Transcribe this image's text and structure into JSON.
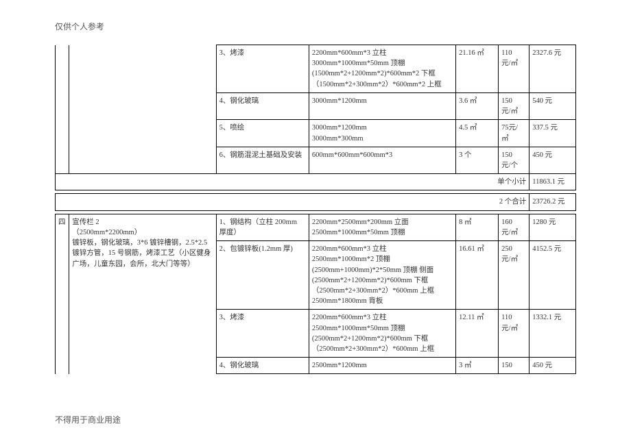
{
  "header_note": "仅供个人参考",
  "footer_note": "不得用于商业用途",
  "section1": {
    "rows": [
      {
        "item": "3、烤漆",
        "spec": "2200mm*600mm*3 立柱\n3000mm*1000mm*50mm 顶棚\n(1500mm*2+1200mm*2)*600mm*2 下框\n（1500mm*2+300mm*2）*600mm*2 上框",
        "qty": "21.16 ㎡",
        "unit_price": "110\n元/㎡",
        "amount": "2327.6 元"
      },
      {
        "item": "4、钢化玻璃",
        "spec": "3000mm*1200mm",
        "qty": "3.6 ㎡",
        "unit_price": "150\n元/㎡",
        "amount": "540 元"
      },
      {
        "item": "5、喷绘",
        "spec": "3000mm*1200mm\n3000mm*300mm",
        "qty": "4.5 ㎡",
        "unit_price": "75元/\n㎡",
        "amount": "337.5 元"
      },
      {
        "item": "6、钢筋混泥土基础及安装",
        "spec": "600mm*600mm*600mm*3",
        "qty": "3 个",
        "unit_price": "150\n元/个",
        "amount": "450 元"
      }
    ],
    "subtotal1": {
      "label": "单个小计",
      "amount": "11863.1 元"
    },
    "subtotal2": {
      "label": "2 个合计",
      "amount": "23726.2 元"
    }
  },
  "section2": {
    "index": "四",
    "desc": "宣传栏 2\n（2500mm*2200mm）\n镀锌板，钢化玻璃，3*6 镀锌槽钢，2.5*2.5 镀锌方管，15 号钢筋，烤漆工艺（小区健身广场，儿童东园，会所，北大门等等）",
    "rows": [
      {
        "item": "1、钢结构（立柱 200mm 厚度）",
        "spec": "2200mm*2500mm*200mm 立面\n2500mm*1000mm*50mm 顶棚",
        "qty": "8 ㎡",
        "unit_price": "160\n元/㎡",
        "amount": "1280 元"
      },
      {
        "item": "2、包镀锌板(1.2mm 厚)",
        "spec": "2200mm*600mm*3 立柱\n2500mm*1000mm*2 顶棚\n(2500mm+1000mm)*2*50mm 顶棚 侧面\n(2500mm*2+1200mm*2)*600mm 下框\n（2500mm*2+300mm*2）*600mm 上框\n2500mm*1800mm 背板",
        "qty": "16.61 ㎡",
        "unit_price": "250\n元/㎡",
        "amount": "4152.5 元"
      },
      {
        "item": "3、烤漆",
        "spec": "2200mm*600mm*3 立柱\n2500mm*1000mm*50mm 顶棚\n(2500mm*2+1200mm*2)*600mm 下框\n（2500mm*2+300mm*2）*600mm 上框",
        "qty": "12.11 ㎡",
        "unit_price": "110\n元/㎡",
        "amount": "1332.1 元"
      },
      {
        "item": "4、钢化玻璃",
        "spec": "2500mm*1200mm",
        "qty": "3 ㎡",
        "unit_price": "150",
        "amount": "450 元"
      }
    ]
  }
}
